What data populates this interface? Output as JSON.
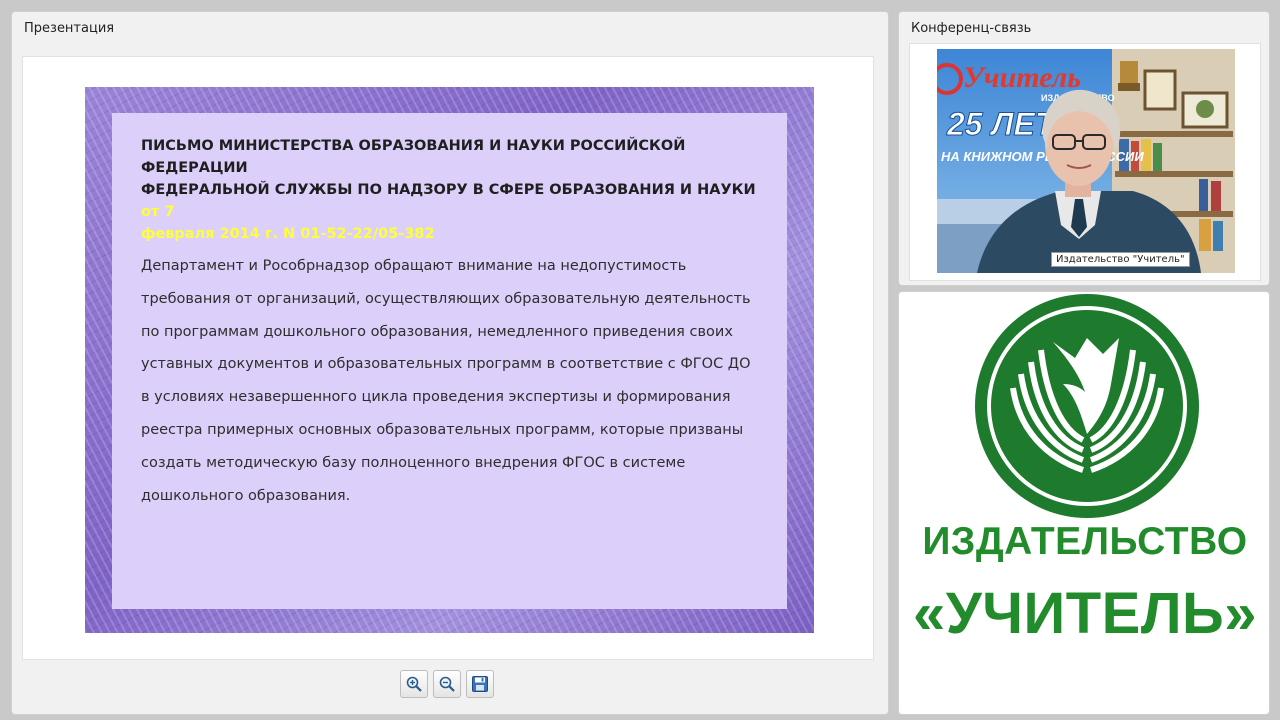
{
  "presentation": {
    "title": "Презентация",
    "slide": {
      "heading_line1": "ПИСЬМО МИНИСТЕРСТВА ОБРАЗОВАНИЯ И НАУКИ РОССИЙСКОЙ ФЕДЕРАЦИИ",
      "heading_line2": "ФЕДЕРАЛЬНОЙ СЛУЖБЫ ПО НАДЗОРУ В СФЕРЕ ОБРАЗОВАНИЯ И НАУКИ",
      "heading_highlight_start": "от 7",
      "heading_highlight_line3": "февраля 2014 г. N 01-52-22/05-382",
      "body_lines": [
        "Департамент и Рособрнадзор обращают внимание на недопустимость",
        "требования от организаций, осуществляющих образовательную деятельность",
        "по программам дошкольного образования, немедленного приведения своих",
        "уставных документов и образовательных программ в соответствие с ФГОС ДО",
        "в условиях незавершенного цикла проведения экспертизы и формирования",
        "реестра примерных основных образовательных программ, которые призваны",
        "создать методическую базу полноценного внедрения ФГОС в системе",
        "дошкольного образования."
      ],
      "highlight_color": "#ffff38"
    },
    "toolbar": [
      {
        "name": "zoom-in",
        "icon": "zoom-in-icon"
      },
      {
        "name": "zoom-out",
        "icon": "zoom-out-icon"
      },
      {
        "name": "save",
        "icon": "save-icon"
      }
    ]
  },
  "conference": {
    "title": "Конференц-связь",
    "participant_label": "Издательство \"Учитель\"",
    "video_banner": {
      "publisher": "Учитель",
      "subtitle": "ИЗДАТЕЛЬСТВО",
      "years": "25 ЛЕТ",
      "slogan": "НА КНИЖНОМ РЫНКЕ РОССИИ"
    }
  },
  "logo": {
    "line1": "ИЗДАТЕЛЬСТВО",
    "line2": "«УЧИТЕЛЬ»",
    "brand_color": "#228b2b"
  }
}
